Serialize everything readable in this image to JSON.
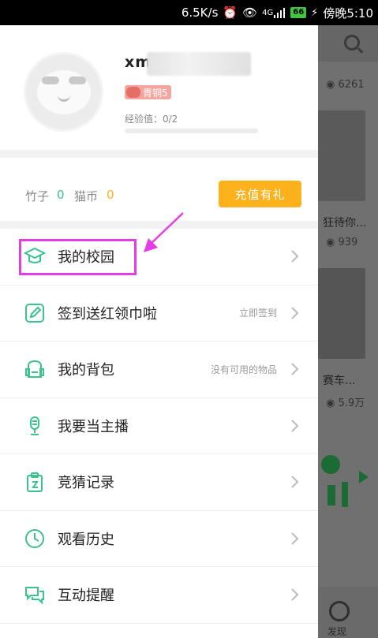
{
  "status_bar": {
    "speed": "6.5K/s",
    "network": "4G",
    "battery": "66",
    "time": "傍晚5:10"
  },
  "profile": {
    "username": "xm          7  ad",
    "level_badge": "青铜5",
    "exp_label": "经验值：0/2",
    "exp_progress": 0
  },
  "wallet": {
    "bamboo_label": "竹子",
    "bamboo_value": "0",
    "catcoin_label": "猫币",
    "catcoin_value": "0",
    "recharge_button": "充值有礼"
  },
  "menu": [
    {
      "label": "我的校园",
      "hint": "",
      "icon": "graduation-cap-icon"
    },
    {
      "label": "签到送红领巾啦",
      "hint": "立即签到",
      "icon": "edit-icon"
    },
    {
      "label": "我的背包",
      "hint": "没有可用的物品",
      "icon": "backpack-icon"
    },
    {
      "label": "我要当主播",
      "hint": "",
      "icon": "microphone-icon"
    },
    {
      "label": "竞猜记录",
      "hint": "",
      "icon": "clipboard-icon"
    },
    {
      "label": "观看历史",
      "hint": "",
      "icon": "clock-icon"
    },
    {
      "label": "互动提醒",
      "hint": "",
      "icon": "chat-bubbles-icon"
    }
  ],
  "background_app": {
    "count_1": "6261",
    "title_1": "狂待你...",
    "count_2": "939",
    "title_2": "赛车...",
    "count_3": "5.9万",
    "nav_label": "发现"
  },
  "colors": {
    "accent_green": "#3bc38c",
    "recharge_orange": "#fdb11b",
    "highlight_magenta": "#e53de6"
  }
}
